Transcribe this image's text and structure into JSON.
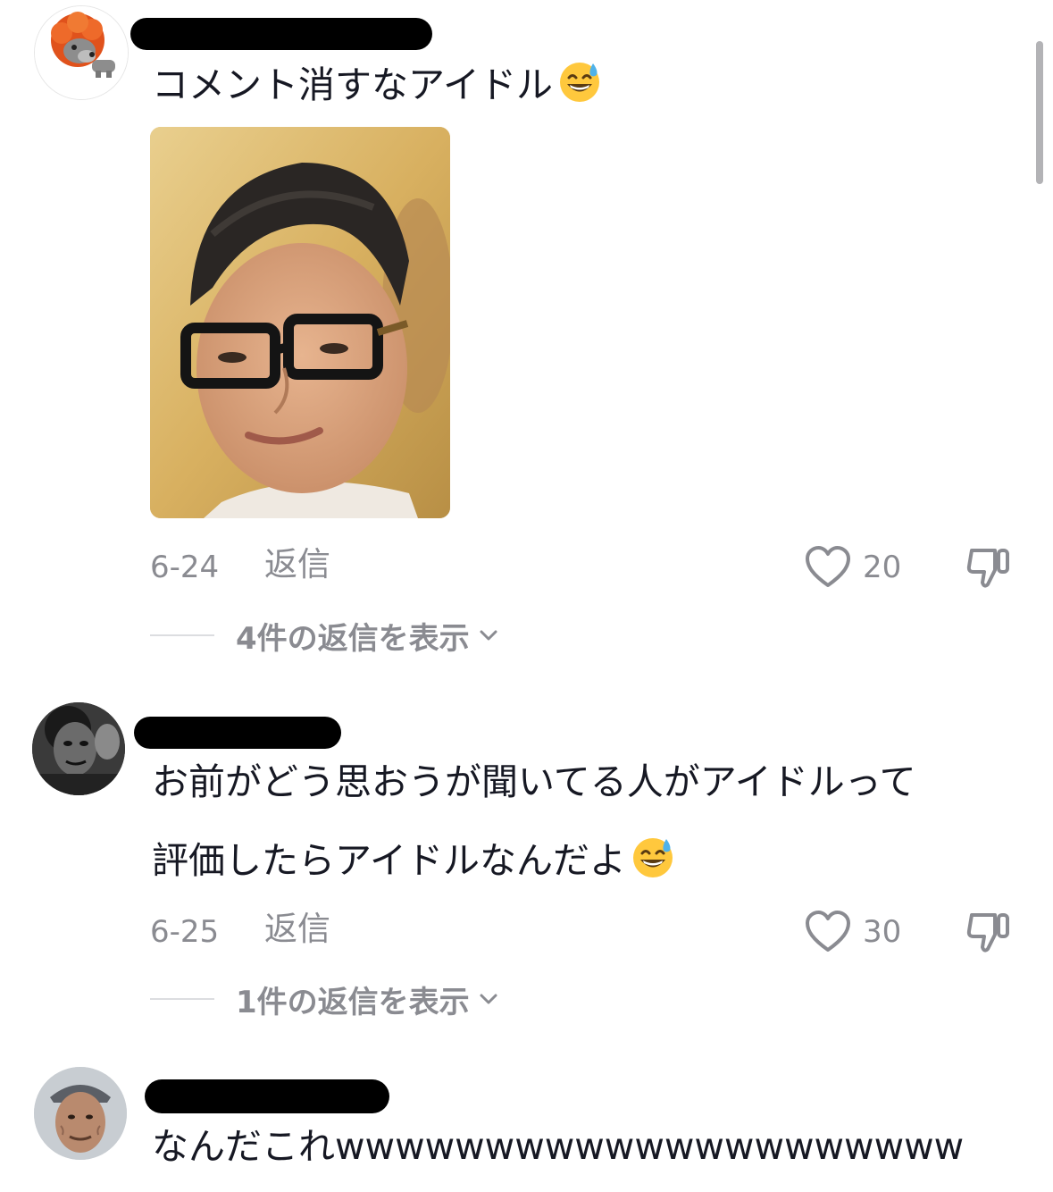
{
  "comments": [
    {
      "text": "コメント消すなアイドル",
      "emoji": "grinning-sweat-emoji",
      "has_photo": true,
      "date": "6-24",
      "reply_label": "返信",
      "likes": "20",
      "view_replies": "4件の返信を表示"
    },
    {
      "text_line1": "お前がどう思おうが聞いてる人がアイドルって",
      "text_line2": "評価したらアイドルなんだよ",
      "emoji": "grinning-sweat-emoji",
      "date": "6-25",
      "reply_label": "返信",
      "likes": "30",
      "view_replies": "1件の返信を表示"
    },
    {
      "text": "なんだこれwwwwwwwwwwwwwwwwwwwww"
    }
  ],
  "colors": {
    "text": "#161823",
    "meta": "#8a8b91",
    "redaction": "#000000",
    "background": "#ffffff"
  }
}
